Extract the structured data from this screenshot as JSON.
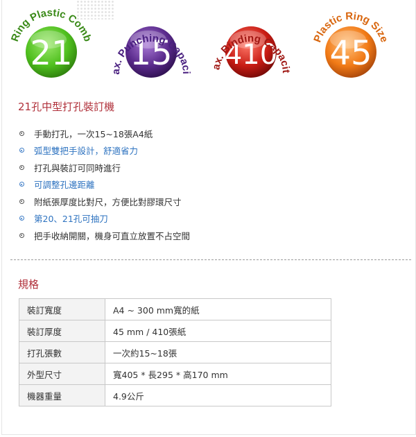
{
  "badges": [
    {
      "number": "21",
      "arc_text": "Ring Plastic Comb",
      "color_light": "#9be86a",
      "color_mid": "#4fbf1e",
      "color_dark": "#2c7a0c",
      "text_color": "#3a8a18"
    },
    {
      "number": "15",
      "arc_text": "Max. Punching Capacity",
      "color_light": "#a97ad6",
      "color_mid": "#5a2a8c",
      "color_dark": "#2c0f4c",
      "text_color": "#4a2080"
    },
    {
      "number": "410",
      "arc_text": "Max. Binding Capacity",
      "color_light": "#ff7a6a",
      "color_mid": "#c81c14",
      "color_dark": "#6e0806",
      "text_color": "#a01814"
    },
    {
      "number": "45",
      "arc_text": "Plastic Ring Size",
      "color_light": "#ffc07a",
      "color_mid": "#f17a16",
      "color_dark": "#a2420a",
      "text_color": "#d8650d"
    }
  ],
  "product_title": "21孔中型打孔裝訂機",
  "features": [
    {
      "text": "手動打孔，一次15~18張A4紙",
      "highlight": false
    },
    {
      "text": "弧型雙把手設計，舒適省力",
      "highlight": true
    },
    {
      "text": "打孔與裝訂可同時進行",
      "highlight": false
    },
    {
      "text": "可調整孔邊距離",
      "highlight": true
    },
    {
      "text": "附紙張厚度比對尺，方便比對膠環尺寸",
      "highlight": false
    },
    {
      "text": "第20、21孔可抽刀",
      "highlight": true
    },
    {
      "text": "把手收納開關，機身可直立放置不占空間",
      "highlight": false
    }
  ],
  "spec_title": "規格",
  "specs": [
    {
      "label": "裝訂寬度",
      "value": "A4 ~ 300 mm寬的紙"
    },
    {
      "label": "裝訂厚度",
      "value": "45 mm / 410張紙"
    },
    {
      "label": "打孔張數",
      "value": "一次約15~18張"
    },
    {
      "label": "外型尺寸",
      "value": "寬405 * 長295 * 高170 mm"
    },
    {
      "label": "機器重量",
      "value": "4.9公斤"
    }
  ],
  "colors": {
    "heading": "#b0303a",
    "highlight_text": "#2e73c0",
    "body_text": "#333333"
  }
}
